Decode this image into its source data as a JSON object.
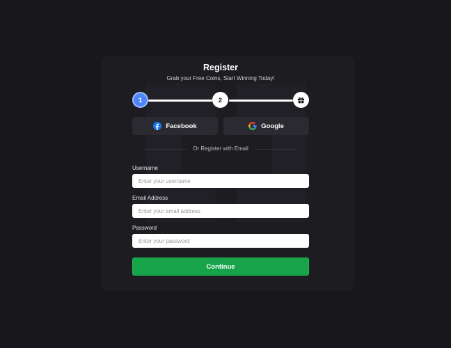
{
  "register": {
    "title": "Register",
    "subtitle": "Grab your Free Coins, Start Winning Today!"
  },
  "stepper": {
    "steps": [
      {
        "label": "1",
        "state": "active"
      },
      {
        "label": "2",
        "state": "upcoming"
      },
      {
        "icon": "gift-icon",
        "state": "upcoming"
      }
    ]
  },
  "social": {
    "facebook_label": "Facebook",
    "google_label": "Google"
  },
  "divider": {
    "text": "Or Register with Email"
  },
  "form": {
    "username": {
      "label": "Username",
      "value": "",
      "placeholder": "Enter your username"
    },
    "email": {
      "label": "Email Address",
      "value": "",
      "placeholder": "Enter your email address"
    },
    "password": {
      "label": "Password",
      "value": "",
      "placeholder": "Enter your password"
    },
    "continue_label": "Continue"
  },
  "colors": {
    "background": "#18181c",
    "card": "#1c1c21",
    "accent_step": "#4f86f7",
    "primary_button": "#16a34a",
    "facebook_blue": "#1877f2"
  }
}
